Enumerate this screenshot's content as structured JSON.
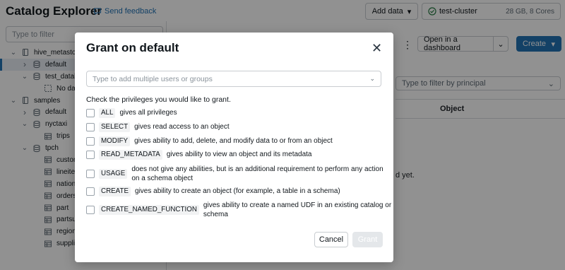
{
  "header": {
    "title": "Catalog Explorer",
    "feedback": "Send feedback",
    "add_data": "Add data",
    "cluster_name": "test-cluster",
    "cluster_resources": "28 GB, 8 Cores"
  },
  "sidebar": {
    "filter_placeholder": "Type to filter",
    "tree": [
      {
        "label": "hive_metastore",
        "level": 0,
        "type": "catalog",
        "expanded": true
      },
      {
        "label": "default",
        "level": 1,
        "type": "schema",
        "expanded": false,
        "selected": true
      },
      {
        "label": "test_database",
        "level": 1,
        "type": "schema",
        "expanded": true
      },
      {
        "label": "No data",
        "level": 2,
        "type": "empty"
      },
      {
        "label": "samples",
        "level": 0,
        "type": "catalog",
        "expanded": true
      },
      {
        "label": "default",
        "level": 1,
        "type": "schema",
        "expanded": false
      },
      {
        "label": "nyctaxi",
        "level": 1,
        "type": "schema",
        "expanded": true
      },
      {
        "label": "trips",
        "level": 2,
        "type": "table"
      },
      {
        "label": "tpch",
        "level": 1,
        "type": "schema",
        "expanded": true
      },
      {
        "label": "customer",
        "level": 2,
        "type": "table"
      },
      {
        "label": "lineitem",
        "level": 2,
        "type": "table"
      },
      {
        "label": "nation",
        "level": 2,
        "type": "table"
      },
      {
        "label": "orders",
        "level": 2,
        "type": "table"
      },
      {
        "label": "part",
        "level": 2,
        "type": "table"
      },
      {
        "label": "partsupp",
        "level": 2,
        "type": "table"
      },
      {
        "label": "region",
        "level": 2,
        "type": "table"
      },
      {
        "label": "supplier",
        "level": 2,
        "type": "table"
      }
    ]
  },
  "main": {
    "open_dashboard": "Open in a dashboard",
    "create": "Create",
    "principal_filter_placeholder": "Type to filter by principal",
    "column_object": "Object",
    "empty_fragment": "d yet."
  },
  "modal": {
    "title": "Grant on default",
    "user_select_placeholder": "Type to add multiple users or groups",
    "instructions": "Check the privileges you would like to grant.",
    "privileges": [
      {
        "code": "ALL",
        "desc": "gives all privileges",
        "checked": false
      },
      {
        "code": "SELECT",
        "desc": "gives read access to an object",
        "checked": false
      },
      {
        "code": "MODIFY",
        "desc": "gives ability to add, delete, and modify data to or from an object",
        "checked": false
      },
      {
        "code": "READ_METADATA",
        "desc": "gives ability to view an object and its metadata",
        "checked": false
      },
      {
        "code": "USAGE",
        "desc": "does not give any abilities, but is an additional requirement to perform any action on a schema object",
        "checked": false
      },
      {
        "code": "CREATE",
        "desc": "gives ability to create an object (for example, a table in a schema)",
        "checked": false
      },
      {
        "code": "CREATE_NAMED_FUNCTION",
        "desc": "gives ability to create a named UDF in an existing catalog or schema",
        "checked": false
      }
    ],
    "cancel_label": "Cancel",
    "grant_label": "Grant"
  },
  "colors": {
    "accent": "#2272b4",
    "overlay": "rgba(0,0,0,0.43)",
    "disabled_button": "#e4e7ea"
  }
}
